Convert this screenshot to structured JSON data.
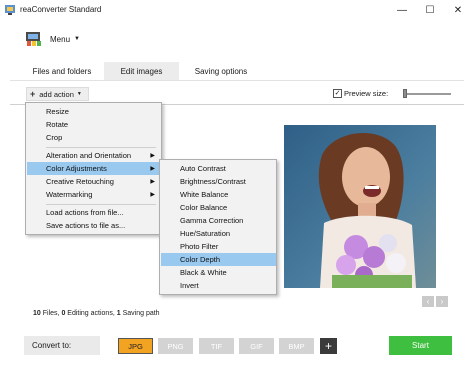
{
  "window": {
    "title": "reaConverter Standard",
    "minimize_glyph": "—",
    "maximize_glyph": "☐",
    "close_glyph": "✕"
  },
  "menu": {
    "label": "Menu",
    "icon": "app-logo-icon"
  },
  "tabs": [
    {
      "label": "Files and folders",
      "active": false
    },
    {
      "label": "Edit images",
      "active": true
    },
    {
      "label": "Saving options",
      "active": false
    }
  ],
  "toolbar": {
    "add_action_label": "add action",
    "preview_label": "Preview size:",
    "preview_checked": true
  },
  "action_menu": {
    "items": [
      {
        "label": "Resize",
        "has_submenu": false,
        "highlighted": false
      },
      {
        "label": "Rotate",
        "has_submenu": false,
        "highlighted": false
      },
      {
        "label": "Crop",
        "has_submenu": false,
        "highlighted": false
      },
      {
        "label": "Alteration and Orientation",
        "has_submenu": true,
        "highlighted": false
      },
      {
        "label": "Color Adjustments",
        "has_submenu": true,
        "highlighted": true
      },
      {
        "label": "Creative Retouching",
        "has_submenu": true,
        "highlighted": false
      },
      {
        "label": "Watermarking",
        "has_submenu": true,
        "highlighted": false
      },
      {
        "label": "Load actions from file...",
        "has_submenu": false,
        "highlighted": false
      },
      {
        "label": "Save actions to file as...",
        "has_submenu": false,
        "highlighted": false
      }
    ]
  },
  "color_submenu": {
    "items": [
      {
        "label": "Auto Contrast",
        "highlighted": false
      },
      {
        "label": "Brightness/Contrast",
        "highlighted": false
      },
      {
        "label": "White Balance",
        "highlighted": false
      },
      {
        "label": "Color Balance",
        "highlighted": false
      },
      {
        "label": "Gamma Correction",
        "highlighted": false
      },
      {
        "label": "Hue/Saturation",
        "highlighted": false
      },
      {
        "label": "Photo Filter",
        "highlighted": false
      },
      {
        "label": "Color Depth",
        "highlighted": true
      },
      {
        "label": "Black & White",
        "highlighted": false
      },
      {
        "label": "Invert",
        "highlighted": false
      }
    ]
  },
  "stats": {
    "files_count": "10",
    "files_label": "Files,",
    "editing_count": "0",
    "editing_label": "Editing actions,",
    "saving_count": "1",
    "saving_label": "Saving path"
  },
  "footer": {
    "convert_label": "Convert to:",
    "formats": [
      {
        "label": "JPG",
        "active": true
      },
      {
        "label": "PNG",
        "active": false
      },
      {
        "label": "TIF",
        "active": false
      },
      {
        "label": "GIF",
        "active": false
      },
      {
        "label": "BMP",
        "active": false
      }
    ],
    "add_format_glyph": "+",
    "start_label": "Start"
  },
  "nav": {
    "prev_glyph": "‹",
    "next_glyph": "›"
  },
  "colors": {
    "accent_orange": "#f3a322",
    "start_green": "#3fbf3f",
    "menu_highlight": "#99c9ef"
  }
}
